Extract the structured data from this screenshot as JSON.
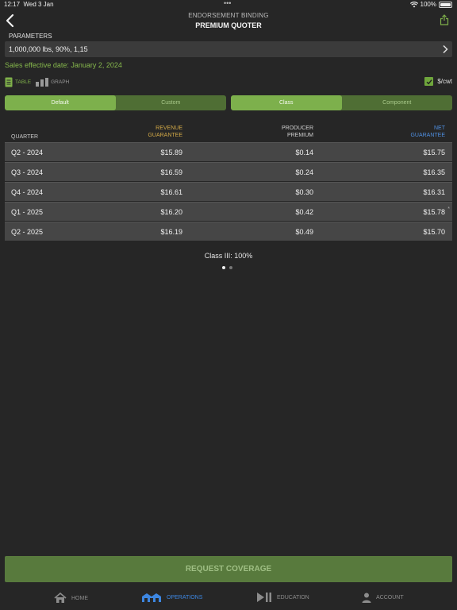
{
  "status": {
    "time": "12:17",
    "date": "Wed 3 Jan",
    "battery": "100%"
  },
  "nav": {
    "subtitle": "ENDORSEMENT BINDING",
    "title": "PREMIUM QUOTER"
  },
  "parameters": {
    "label": "PARAMETERS",
    "value": "1,000,000 lbs, 90%, 1,15"
  },
  "effective_date": "Sales effective date: January 2, 2024",
  "view_toggle": {
    "table": "TABLE",
    "graph": "GRAPH"
  },
  "unit_toggle": {
    "label": "$/cwt",
    "checked": true
  },
  "segment_left": {
    "options": [
      "Default",
      "Custom"
    ],
    "selected": "Default"
  },
  "segment_right": {
    "options": [
      "Class",
      "Component"
    ],
    "selected": "Class"
  },
  "table": {
    "headers": {
      "quarter": "QUARTER",
      "revenue": "REVENUE GUARANTEE",
      "producer": "PRODUCER PREMIUM",
      "net": "NET GUARANTEE"
    },
    "rows": [
      {
        "quarter": "Q2 - 2024",
        "revenue": "$15.89",
        "producer": "$0.14",
        "net": "$15.75",
        "mark": ""
      },
      {
        "quarter": "Q3 - 2024",
        "revenue": "$16.59",
        "producer": "$0.24",
        "net": "$16.35",
        "mark": ""
      },
      {
        "quarter": "Q4 - 2024",
        "revenue": "$16.61",
        "producer": "$0.30",
        "net": "$16.31",
        "mark": ""
      },
      {
        "quarter": "Q1 - 2025",
        "revenue": "$16.20",
        "producer": "$0.42",
        "net": "$15.78",
        "mark": "*"
      },
      {
        "quarter": "Q2 - 2025",
        "revenue": "$16.19",
        "producer": "$0.49",
        "net": "$15.70",
        "mark": ""
      }
    ]
  },
  "class_line": "Class III: 100%",
  "pager": {
    "pages": 2,
    "current": 1
  },
  "request_button": "REQUEST COVERAGE",
  "tabs": [
    {
      "label": "HOME",
      "icon": "home-icon"
    },
    {
      "label": "OPERATIONS",
      "icon": "barn-icon"
    },
    {
      "label": "EDUCATION",
      "icon": "play-pause-icon"
    },
    {
      "label": "ACCOUNT",
      "icon": "person-icon"
    }
  ],
  "colors": {
    "background": "#262626",
    "accent_green": "#7db04c",
    "revenue_header": "#d1a847",
    "net_header": "#4f8fe0",
    "tab_active": "#3d86e0"
  }
}
